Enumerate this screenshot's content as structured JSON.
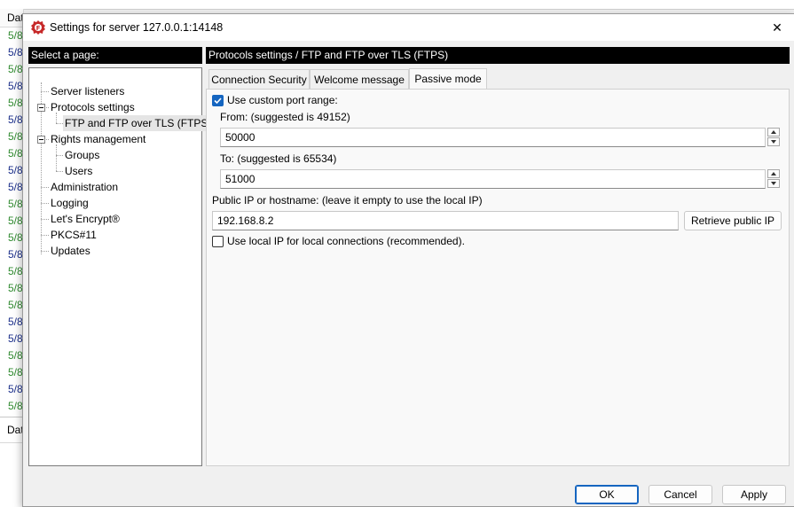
{
  "background": {
    "log_header": "Dat",
    "log_rows": [
      "5/8",
      "5/8",
      "5/8",
      "5/8",
      "5/8",
      "5/8",
      "5/8",
      "5/8",
      "5/8",
      "5/8",
      "5/8",
      "5/8",
      "5/8",
      "5/8",
      "5/8",
      "5/8",
      "5/8",
      "5/8",
      "5/8",
      "5/8",
      "5/8",
      "5/8",
      "5/8"
    ],
    "bottom_header": "Dat"
  },
  "dialog": {
    "title": "Settings for server 127.0.0.1:14148",
    "close_glyph": "✕",
    "page_selector_label": "Select a page:",
    "tree": {
      "items": [
        {
          "label": "Server listeners"
        },
        {
          "label": "Protocols settings"
        },
        {
          "label": "FTP and FTP over TLS (FTPS)"
        },
        {
          "label": "Rights management"
        },
        {
          "label": "Groups"
        },
        {
          "label": "Users"
        },
        {
          "label": "Administration"
        },
        {
          "label": "Logging"
        },
        {
          "label": "Let's Encrypt®"
        },
        {
          "label": "PKCS#11"
        },
        {
          "label": "Updates"
        }
      ]
    },
    "section_title": "Protocols settings / FTP and FTP over TLS (FTPS)",
    "tabs": [
      {
        "label": "Connection Security"
      },
      {
        "label": "Welcome message"
      },
      {
        "label": "Passive mode"
      }
    ],
    "passive": {
      "use_custom_range_label": "Use custom port range:",
      "use_custom_range_checked": true,
      "from_label": "From: (suggested is 49152)",
      "from_value": "50000",
      "to_label": "To: (suggested is 65534)",
      "to_value": "51000",
      "public_ip_label": "Public IP or hostname: (leave it empty to use the local IP)",
      "public_ip_value": "192.168.8.2",
      "retrieve_button": "Retrieve public IP",
      "use_local_ip_label": "Use local IP for local connections (recommended).",
      "use_local_ip_checked": false
    },
    "buttons": {
      "ok": "OK",
      "cancel": "Cancel",
      "apply": "Apply"
    },
    "colors": {
      "accent": "#1565c0",
      "header_bg": "#000000"
    }
  }
}
